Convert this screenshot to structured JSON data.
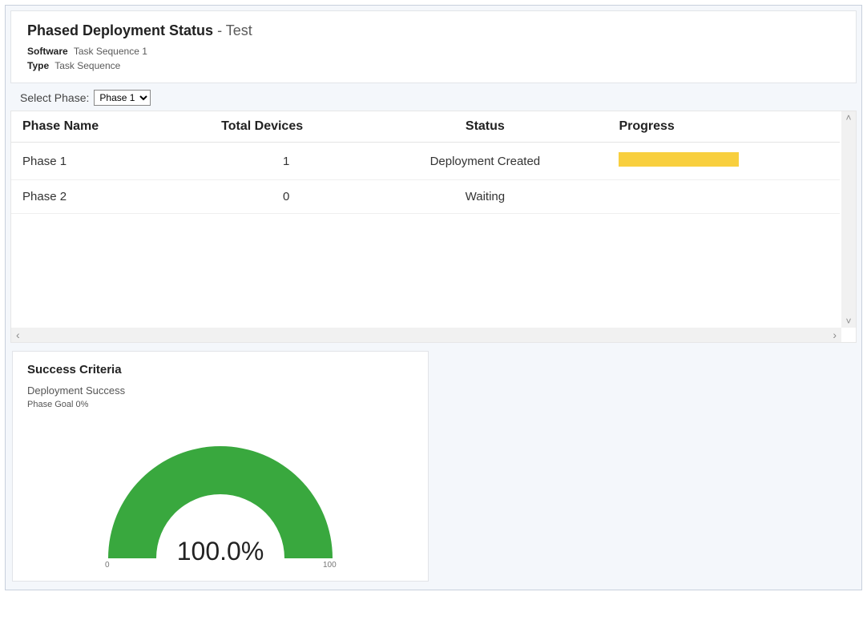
{
  "header": {
    "title_bold": "Phased Deployment Status",
    "title_suffix": " - Test",
    "software_label": "Software",
    "software_value": "Task Sequence 1",
    "type_label": "Type",
    "type_value": "Task Sequence"
  },
  "phase_picker": {
    "label": "Select Phase:",
    "selected": "Phase 1",
    "options": [
      "Phase 1",
      "Phase 2"
    ]
  },
  "table": {
    "columns": {
      "name": "Phase Name",
      "devices": "Total Devices",
      "status": "Status",
      "progress": "Progress"
    },
    "rows": [
      {
        "name": "Phase 1",
        "devices": "1",
        "status": "Deployment Created",
        "has_progress_bar": true
      },
      {
        "name": "Phase 2",
        "devices": "0",
        "status": "Waiting",
        "has_progress_bar": false
      }
    ]
  },
  "criteria": {
    "title": "Success Criteria",
    "subtitle": "Deployment Success",
    "goal_text": "Phase Goal 0%"
  },
  "chart_data": {
    "type": "gauge",
    "title": "Success Criteria",
    "value_pct": 100.0,
    "display_value": "100.0%",
    "range_min": 0,
    "range_max": 100,
    "tick_min_label": "0",
    "tick_max_label": "100",
    "fill_color": "#39a83e"
  }
}
